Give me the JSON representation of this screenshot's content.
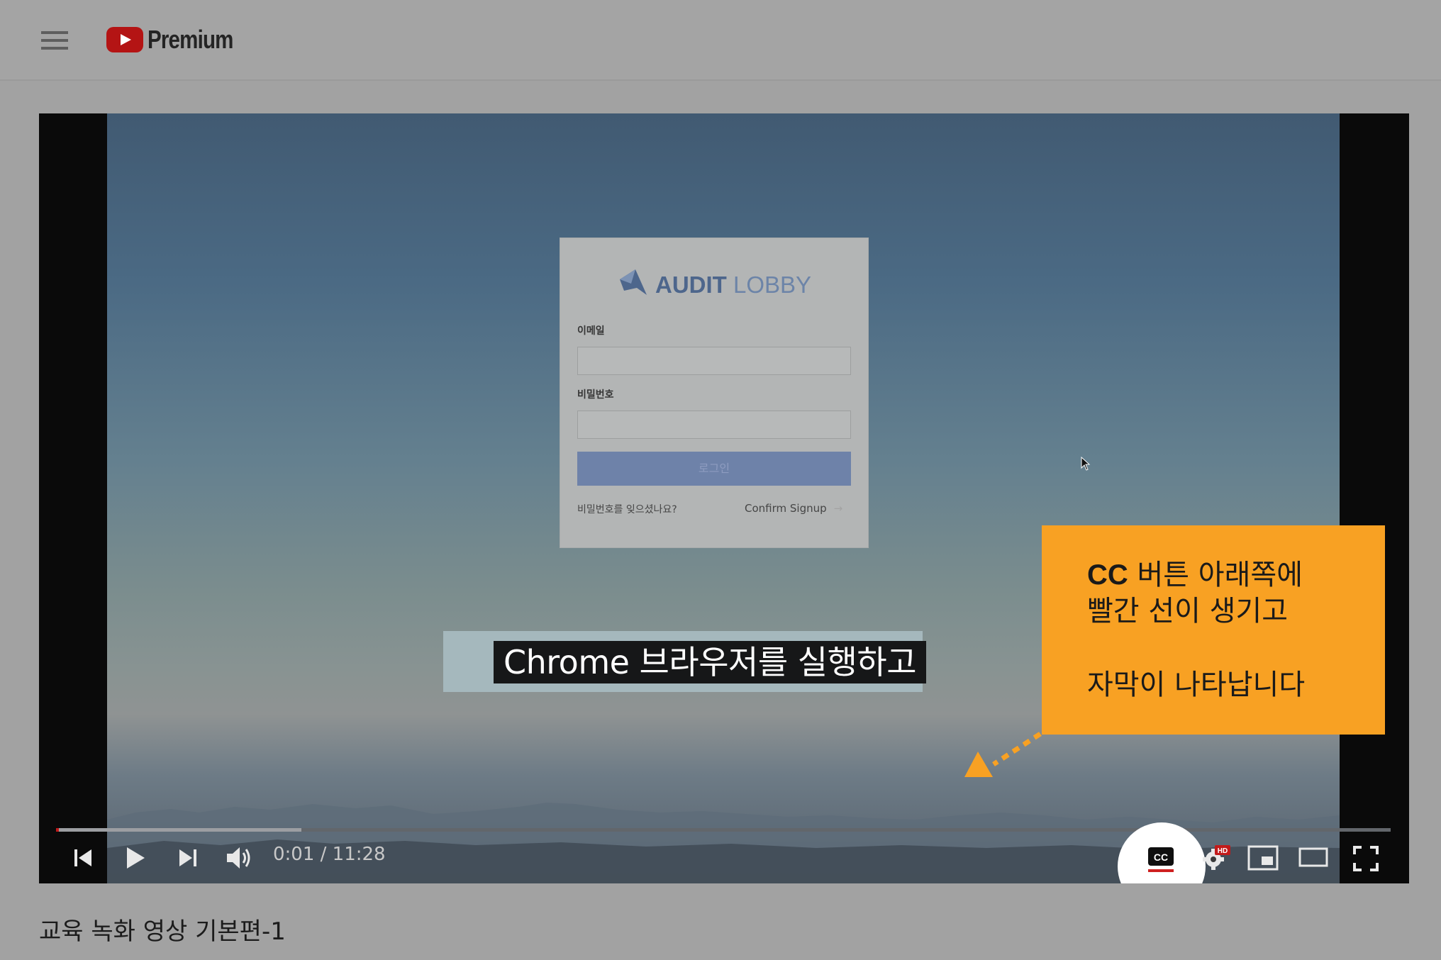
{
  "app": {
    "brand": "Premium"
  },
  "login": {
    "logo_bold": "AUDIT",
    "logo_light": "LOBBY",
    "email_label": "이메일",
    "password_label": "비밀번호",
    "login_button": "로그인",
    "forgot_link": "비밀번호를 잊으셨나요?",
    "confirm_link": "Confirm Signup",
    "confirm_arrow": "→"
  },
  "subtitle": "Chrome 브라우저를 실행하고",
  "player": {
    "current_time": "0:01",
    "duration": "11:28",
    "time_display": "0:01 / 11:28",
    "progress_fraction": 0.0015,
    "buffered_fraction": 0.184,
    "hd_badge": "HD",
    "cc_label": "CC",
    "accent_color": "#c21a1a"
  },
  "callout": {
    "line1_bold": "CC",
    "line1_rest": " 버튼 아래쪽에",
    "line2": "빨간 선이 생기고",
    "line3": "자막이 나타납니다",
    "color": "#f8a123"
  },
  "video_title": "교육 녹화 영상 기본편-1"
}
